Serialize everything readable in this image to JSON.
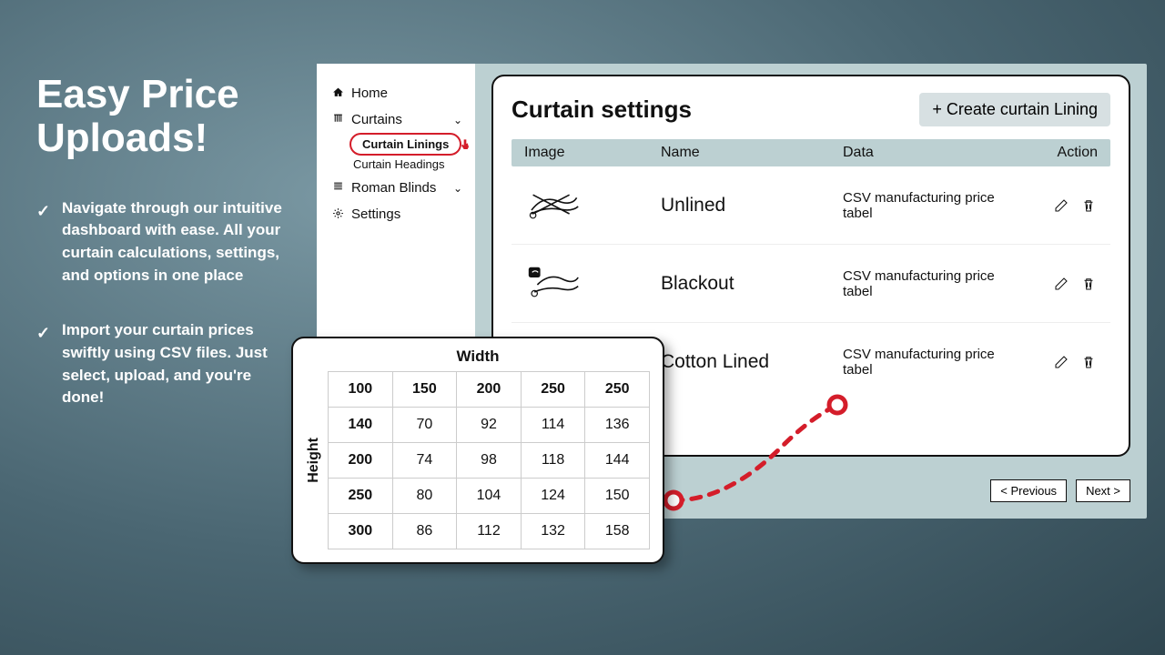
{
  "marketing": {
    "title": "Easy Price Uploads!",
    "bullets": [
      "Navigate through our intuitive dashboard with ease. All your curtain calculations, settings, and options in one place",
      "Import your curtain prices swiftly using CSV files. Just select, upload, and you're done!"
    ]
  },
  "sidebar": {
    "items": [
      {
        "icon": "home",
        "label": "Home"
      },
      {
        "icon": "curtains",
        "label": "Curtains",
        "expandable": true,
        "children": [
          "Curtain Linings",
          "Curtain Headings"
        ],
        "selected_child": 0
      },
      {
        "icon": "blinds",
        "label": "Roman Blinds",
        "expandable": true
      },
      {
        "icon": "gear",
        "label": "Settings"
      }
    ]
  },
  "panel": {
    "title": "Curtain settings",
    "create_label": "+ Create curtain Lining",
    "columns": {
      "image": "Image",
      "name": "Name",
      "data": "Data",
      "action": "Action"
    },
    "rows": [
      {
        "name": "Unlined",
        "data": "CSV manufacturing price tabel",
        "img": "unlined"
      },
      {
        "name": "Blackout",
        "data": "CSV manufacturing price tabel",
        "img": "blackout"
      },
      {
        "name": "Cotton Lined",
        "data": "CSV manufacturing price tabel",
        "img": "cotton"
      }
    ],
    "pager": {
      "prev": "< Previous",
      "next": "Next >"
    }
  },
  "chart_data": {
    "type": "table",
    "title": null,
    "xlabel": "Width",
    "ylabel": "Height",
    "col_headers": [
      100,
      150,
      200,
      250,
      250
    ],
    "row_headers": [
      140,
      200,
      250,
      300
    ],
    "cells": [
      [
        null,
        70,
        92,
        114,
        136
      ],
      [
        null,
        74,
        98,
        118,
        144
      ],
      [
        null,
        80,
        104,
        124,
        150
      ],
      [
        null,
        86,
        112,
        132,
        158
      ]
    ]
  }
}
